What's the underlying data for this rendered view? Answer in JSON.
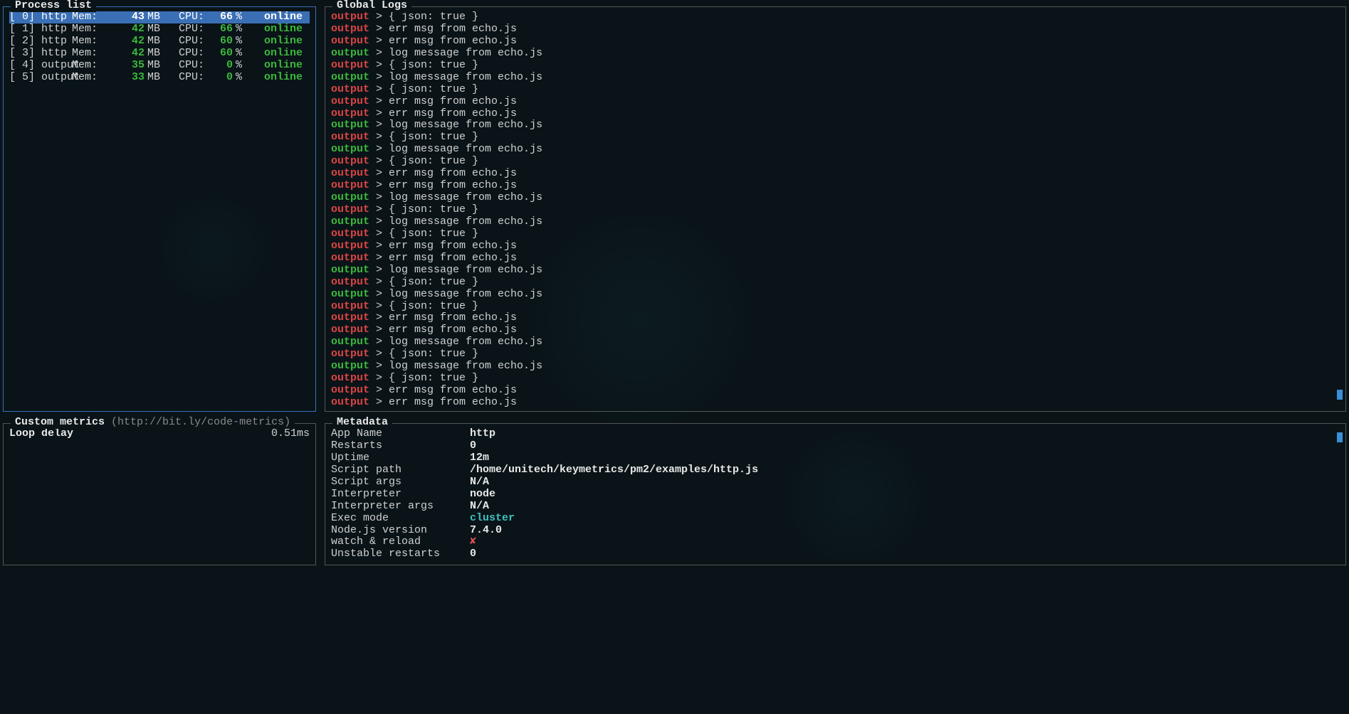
{
  "panels": {
    "process_list_title": "Process list",
    "global_logs_title": "Global Logs",
    "custom_metrics_title": "Custom metrics",
    "custom_metrics_hint": "(http://bit.ly/code-metrics)",
    "metadata_title": "Metadata"
  },
  "processes": [
    {
      "id": "[ 0]",
      "name": "http",
      "mem_label": "Mem:",
      "mem": "43",
      "mem_unit": "MB",
      "cpu_label": "CPU:",
      "cpu": "66",
      "pct": "%",
      "status": "online",
      "selected": true
    },
    {
      "id": "[ 1]",
      "name": "http",
      "mem_label": "Mem:",
      "mem": "42",
      "mem_unit": "MB",
      "cpu_label": "CPU:",
      "cpu": "66",
      "pct": "%",
      "status": "online",
      "selected": false
    },
    {
      "id": "[ 2]",
      "name": "http",
      "mem_label": "Mem:",
      "mem": "42",
      "mem_unit": "MB",
      "cpu_label": "CPU:",
      "cpu": "60",
      "pct": "%",
      "status": "online",
      "selected": false
    },
    {
      "id": "[ 3]",
      "name": "http",
      "mem_label": "Mem:",
      "mem": "42",
      "mem_unit": "MB",
      "cpu_label": "CPU:",
      "cpu": "60",
      "pct": "%",
      "status": "online",
      "selected": false
    },
    {
      "id": "[ 4]",
      "name": "output",
      "mem_label": "Mem:",
      "mem": "35",
      "mem_unit": "MB",
      "cpu_label": "CPU:",
      "cpu": "0",
      "pct": "%",
      "status": "online",
      "selected": false
    },
    {
      "id": "[ 5]",
      "name": "output",
      "mem_label": "Mem:",
      "mem": "33",
      "mem_unit": "MB",
      "cpu_label": "CPU:",
      "cpu": "0",
      "pct": "%",
      "status": "online",
      "selected": false
    }
  ],
  "logs": [
    {
      "src": "output",
      "type": "err",
      "msg": "{ json: true }"
    },
    {
      "src": "output",
      "type": "err",
      "msg": "err msg from echo.js"
    },
    {
      "src": "output",
      "type": "err",
      "msg": "err msg from echo.js"
    },
    {
      "src": "output",
      "type": "out",
      "msg": "log message from echo.js"
    },
    {
      "src": "output",
      "type": "err",
      "msg": "{ json: true }"
    },
    {
      "src": "output",
      "type": "out",
      "msg": "log message from echo.js"
    },
    {
      "src": "output",
      "type": "err",
      "msg": "{ json: true }"
    },
    {
      "src": "output",
      "type": "err",
      "msg": "err msg from echo.js"
    },
    {
      "src": "output",
      "type": "err",
      "msg": "err msg from echo.js"
    },
    {
      "src": "output",
      "type": "out",
      "msg": "log message from echo.js"
    },
    {
      "src": "output",
      "type": "err",
      "msg": "{ json: true }"
    },
    {
      "src": "output",
      "type": "out",
      "msg": "log message from echo.js"
    },
    {
      "src": "output",
      "type": "err",
      "msg": "{ json: true }"
    },
    {
      "src": "output",
      "type": "err",
      "msg": "err msg from echo.js"
    },
    {
      "src": "output",
      "type": "err",
      "msg": "err msg from echo.js"
    },
    {
      "src": "output",
      "type": "out",
      "msg": "log message from echo.js"
    },
    {
      "src": "output",
      "type": "err",
      "msg": "{ json: true }"
    },
    {
      "src": "output",
      "type": "out",
      "msg": "log message from echo.js"
    },
    {
      "src": "output",
      "type": "err",
      "msg": "{ json: true }"
    },
    {
      "src": "output",
      "type": "err",
      "msg": "err msg from echo.js"
    },
    {
      "src": "output",
      "type": "err",
      "msg": "err msg from echo.js"
    },
    {
      "src": "output",
      "type": "out",
      "msg": "log message from echo.js"
    },
    {
      "src": "output",
      "type": "err",
      "msg": "{ json: true }"
    },
    {
      "src": "output",
      "type": "out",
      "msg": "log message from echo.js"
    },
    {
      "src": "output",
      "type": "err",
      "msg": "{ json: true }"
    },
    {
      "src": "output",
      "type": "err",
      "msg": "err msg from echo.js"
    },
    {
      "src": "output",
      "type": "err",
      "msg": "err msg from echo.js"
    },
    {
      "src": "output",
      "type": "out",
      "msg": "log message from echo.js"
    },
    {
      "src": "output",
      "type": "err",
      "msg": "{ json: true }"
    },
    {
      "src": "output",
      "type": "out",
      "msg": "log message from echo.js"
    },
    {
      "src": "output",
      "type": "err",
      "msg": "{ json: true }"
    },
    {
      "src": "output",
      "type": "err",
      "msg": "err msg from echo.js"
    },
    {
      "src": "output",
      "type": "err",
      "msg": "err msg from echo.js"
    }
  ],
  "log_separator": " > ",
  "metrics": [
    {
      "name": "Loop delay",
      "value": "0.51ms"
    }
  ],
  "metadata": [
    {
      "key": "App Name",
      "value": "http",
      "style": "bold"
    },
    {
      "key": "Restarts",
      "value": "0",
      "style": ""
    },
    {
      "key": "Uptime",
      "value": "12m",
      "style": ""
    },
    {
      "key": "Script path",
      "value": "/home/unitech/keymetrics/pm2/examples/http.js",
      "style": ""
    },
    {
      "key": "Script args",
      "value": "N/A",
      "style": ""
    },
    {
      "key": "Interpreter",
      "value": "node",
      "style": ""
    },
    {
      "key": "Interpreter args",
      "value": "N/A",
      "style": ""
    },
    {
      "key": "Exec mode",
      "value": "cluster",
      "style": "cyan"
    },
    {
      "key": "Node.js version",
      "value": "7.4.0",
      "style": ""
    },
    {
      "key": "watch & reload",
      "value": "✘",
      "style": "red"
    },
    {
      "key": "Unstable restarts",
      "value": "0",
      "style": ""
    }
  ]
}
